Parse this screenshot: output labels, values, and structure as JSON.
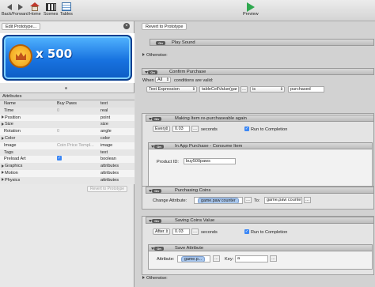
{
  "toolbar": {
    "back_forward": "Back/Forward",
    "home": "Home",
    "scenes": "Scenes",
    "tables": "Tables",
    "preview": "Preview"
  },
  "left": {
    "edit_prototype": "Edit Prototype...",
    "coin_amount": "x 500",
    "attributes_title": "Attributes",
    "columns": {
      "name": "Name",
      "value": "Buy Paws",
      "type": "text"
    },
    "rows": [
      {
        "name": "Time",
        "value": "0",
        "type": "real"
      },
      {
        "name": "Position",
        "value": "",
        "type": "point"
      },
      {
        "name": "Size",
        "value": "",
        "type": "size"
      },
      {
        "name": "Rotation",
        "value": "0",
        "type": "angle"
      },
      {
        "name": "Color",
        "value": "",
        "type": "color"
      },
      {
        "name": "Image",
        "value": "Coin Price Templ...",
        "type": "image"
      },
      {
        "name": "Tags",
        "value": "",
        "type": "text"
      },
      {
        "name": "Preload Art",
        "value": "✓",
        "type": "boolean"
      },
      {
        "name": "Graphics",
        "value": "",
        "type": "attributes"
      },
      {
        "name": "Motion",
        "value": "",
        "type": "attributes"
      },
      {
        "name": "Physics",
        "value": "",
        "type": "attributes"
      }
    ],
    "revert_small": "Revert to Prototype"
  },
  "right": {
    "revert_to_prototype": "Revert to Prototype",
    "on": "On",
    "play_sound": "Play Sound",
    "otherwise": "Otherwise:",
    "confirm_purchase": "Confirm Purchase",
    "when": "When",
    "when_value": "All",
    "conditions": "conditions are valid:",
    "cond_type": "Text Expression",
    "cond_left": "tableCellValue(gar",
    "cond_op": "is",
    "cond_right": "purchased",
    "remake": "Making Item re-purchaseable again",
    "every": "Every",
    "every_value": "0.03",
    "seconds": "seconds",
    "run_to_completion": "Run to Completion",
    "in_app": "In App Purchase - Consume Item",
    "product_id_label": "Product ID:",
    "product_id": "buy500paws",
    "purchasing_coins": "Purchasing Coins",
    "change_attribute": "Change Attribute:",
    "attr_target": "game.paw counter",
    "to": "To:",
    "attr_value": "game.paw counte",
    "saving_coins": "Saving Coins Value",
    "after": "After",
    "after_value": "0.03",
    "save_attribute": "Save Attribute",
    "attribute_label": "Attribute:",
    "save_attr_value": "game.p...",
    "key_label": "Key:",
    "key_value": "a",
    "otherwise_bottom": "Otherwise:"
  },
  "colors": {
    "accent_blue": "#3b87f5",
    "coin_blue": "#1873e0",
    "play_green": "#2fa84f"
  }
}
